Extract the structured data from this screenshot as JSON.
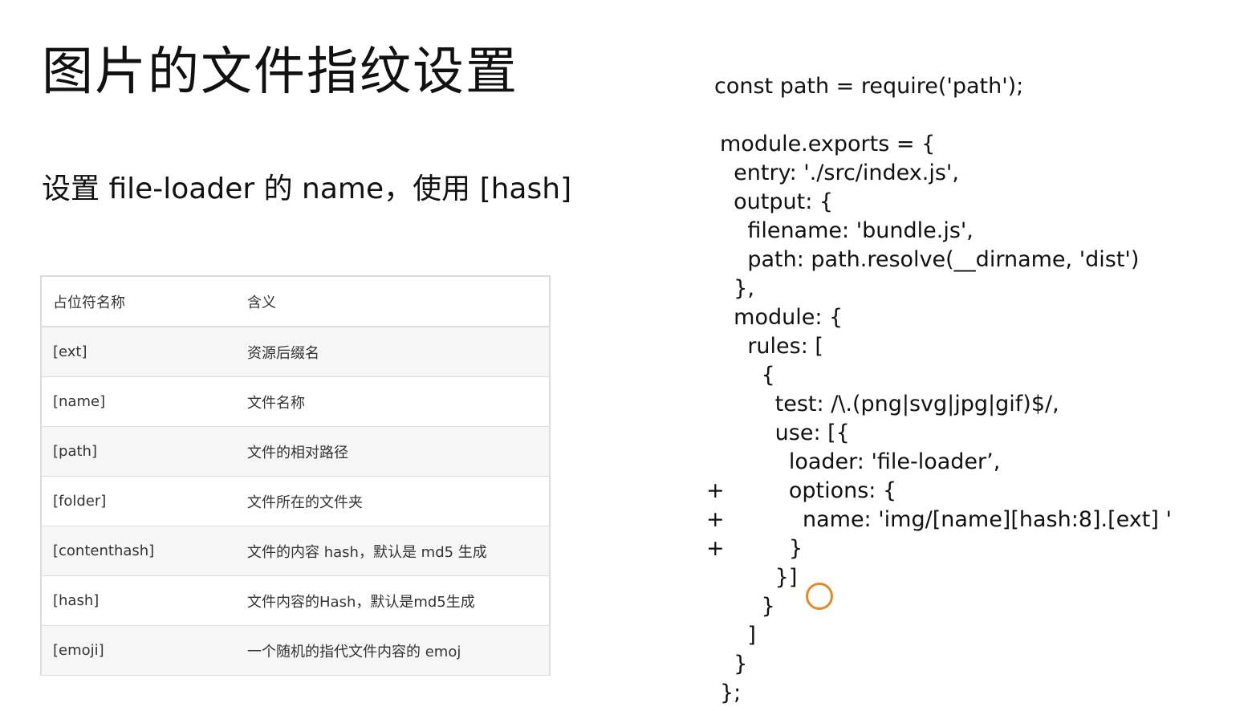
{
  "title": "图片的文件指纹设置",
  "subtitle": "设置 file-loader 的 name，使用 [hash]",
  "table": {
    "headers": [
      "占位符名称",
      "含义"
    ],
    "rows": [
      [
        "[ext]",
        "资源后缀名"
      ],
      [
        "[name]",
        "文件名称"
      ],
      [
        "[path]",
        "文件的相对路径"
      ],
      [
        "[folder]",
        "文件所在的文件夹"
      ],
      [
        "[contenthash]",
        "文件的内容 hash，默认是 md5 生成"
      ],
      [
        "[hash]",
        "文件内容的Hash，默认是md5生成"
      ],
      [
        "[emoji]",
        "一个随机的指代文件内容的 emoj"
      ]
    ]
  },
  "code": {
    "lines": [
      "const path = require('path');",
      "module.exports = {",
      "  entry: './src/index.js',",
      "  output: {",
      "    filename: 'bundle.js',",
      "    path: path.resolve(__dirname, 'dist')",
      "  },",
      "  module: {",
      "    rules: [",
      "      {",
      "        test: /\\.(png|svg|jpg|gif)$/,",
      "        use: [{",
      "          loader: 'file-loader’,",
      "          options: {",
      "            name: 'img/[name][hash:8].[ext] '",
      "          }",
      "        }]",
      "      }",
      "    ]",
      "  }",
      "};"
    ],
    "diff_markers": [
      "+",
      "+",
      "+"
    ]
  }
}
